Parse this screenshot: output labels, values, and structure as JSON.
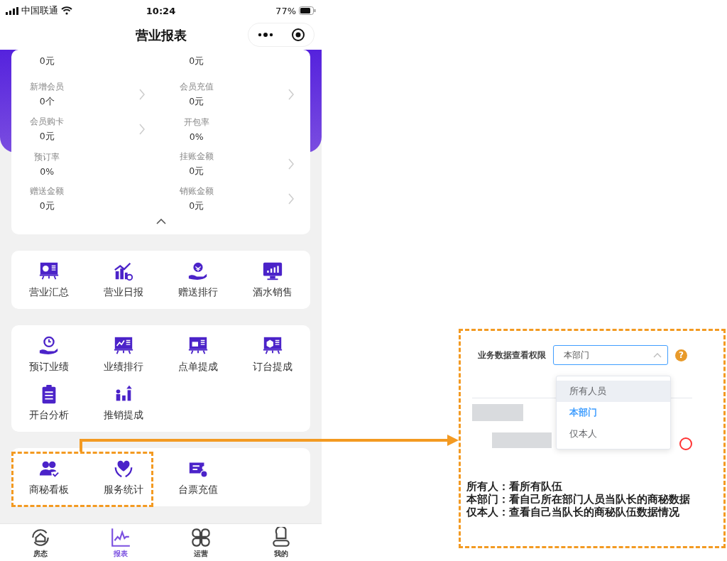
{
  "status_bar": {
    "carrier": "中国联通",
    "time": "10:24",
    "battery": "77%"
  },
  "nav_bar": {
    "title": "营业报表"
  },
  "stats": [
    {
      "value": "0元",
      "arrow": false
    },
    {
      "value": "0元",
      "arrow": false
    },
    {
      "label": "新增会员",
      "value": "0个",
      "arrow": true
    },
    {
      "label": "会员充值",
      "value": "0元",
      "arrow": true
    },
    {
      "label": "会员购卡",
      "value": "0元",
      "arrow": true
    },
    {
      "label": "开包率",
      "value": "0%",
      "arrow": false
    },
    {
      "label": "预订率",
      "value": "0%",
      "arrow": false
    },
    {
      "label": "挂账金额",
      "value": "0元",
      "arrow": true
    },
    {
      "label": "赠送金额",
      "value": "0元",
      "arrow": false
    },
    {
      "label": "销账金额",
      "value": "0元",
      "arrow": true
    }
  ],
  "menu_groups": [
    [
      {
        "label": "营业汇总"
      },
      {
        "label": "营业日报"
      },
      {
        "label": "赠送排行"
      },
      {
        "label": "酒水销售"
      }
    ],
    [
      {
        "label": "预订业绩"
      },
      {
        "label": "业绩排行"
      },
      {
        "label": "点单提成"
      },
      {
        "label": "订台提成"
      },
      {
        "label": "开台分析"
      },
      {
        "label": "推销提成"
      }
    ],
    [
      {
        "label": "商秘看板"
      },
      {
        "label": "服务统计"
      },
      {
        "label": "台票充值"
      }
    ]
  ],
  "tab_bar": [
    {
      "label": "房态",
      "selected": false
    },
    {
      "label": "报表",
      "selected": true
    },
    {
      "label": "运营",
      "selected": false
    },
    {
      "label": "我的",
      "selected": false
    }
  ],
  "annotation": {
    "field_label": "业务数据查看权限",
    "select_value": "本部门",
    "expanded": true,
    "help": "?",
    "options": [
      {
        "label": "所有人员",
        "selected": false,
        "hovered": true
      },
      {
        "label": "本部门",
        "selected": true,
        "hovered": false
      },
      {
        "label": "仅本人",
        "selected": false,
        "hovered": false
      }
    ],
    "notes": [
      "所有人：看所有队伍",
      "本部门：看自己所在部门人员当队长的商秘数据",
      "仅本人：查看自己当队长的商秘队伍数据情况"
    ]
  }
}
